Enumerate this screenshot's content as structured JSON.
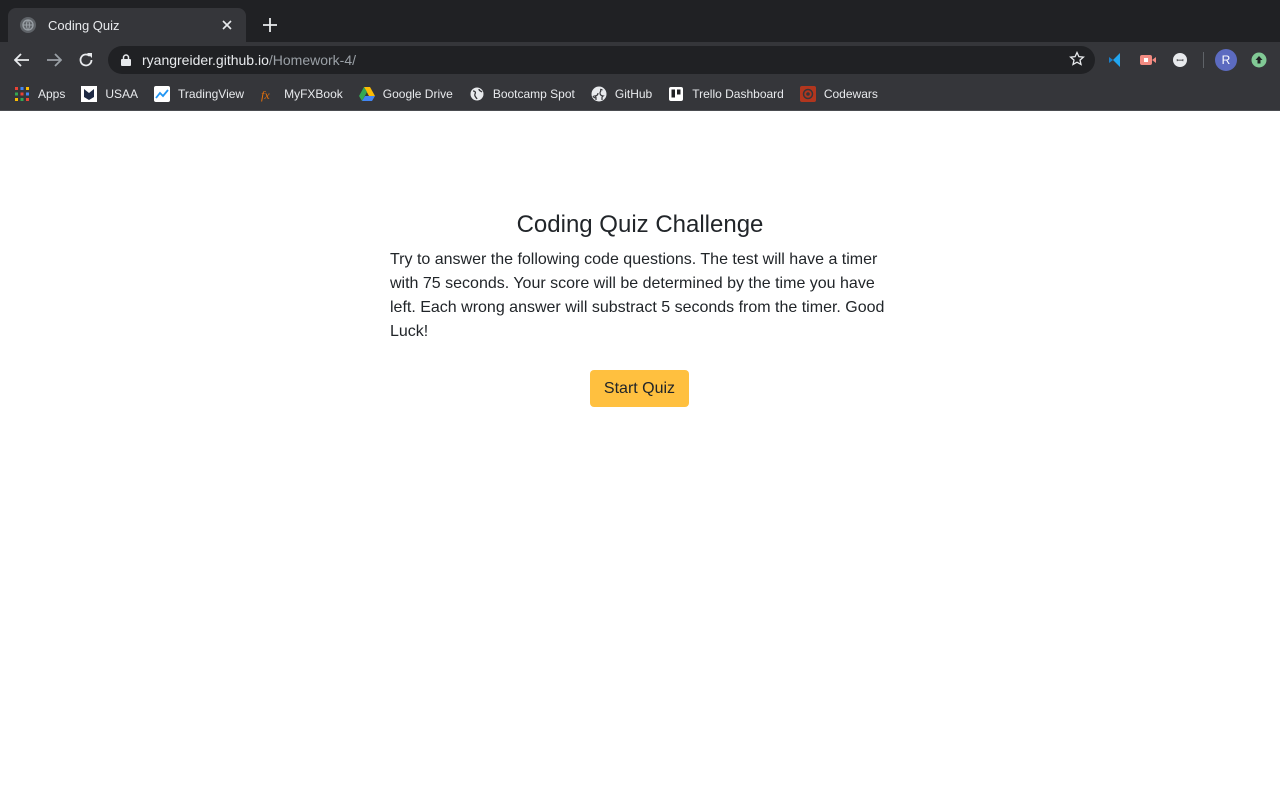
{
  "browser": {
    "tab_title": "Coding Quiz",
    "url_host": "ryangreider.github.io",
    "url_path": "/Homework-4/",
    "profile_initial": "R"
  },
  "bookmarks": [
    {
      "label": "Apps",
      "icon": "apps-grid-icon"
    },
    {
      "label": "USAA",
      "icon": "usaa-icon"
    },
    {
      "label": "TradingView",
      "icon": "tradingview-icon"
    },
    {
      "label": "MyFXBook",
      "icon": "myfxbook-icon"
    },
    {
      "label": "Google Drive",
      "icon": "google-drive-icon"
    },
    {
      "label": "Bootcamp Spot",
      "icon": "globe-icon"
    },
    {
      "label": "GitHub",
      "icon": "github-icon"
    },
    {
      "label": "Trello Dashboard",
      "icon": "trello-icon"
    },
    {
      "label": "Codewars",
      "icon": "codewars-icon"
    }
  ],
  "quiz": {
    "title": "Coding Quiz Challenge",
    "description": "Try to answer the following code questions. The test will have a timer with 75 seconds. Your score will be determined by the time you have left. Each wrong answer will substract 5 seconds from the timer. Good Luck!",
    "start_label": "Start Quiz"
  },
  "colors": {
    "start_button": "#ffc03f",
    "chrome_bg": "#202124",
    "toolbar_bg": "#35363a"
  }
}
